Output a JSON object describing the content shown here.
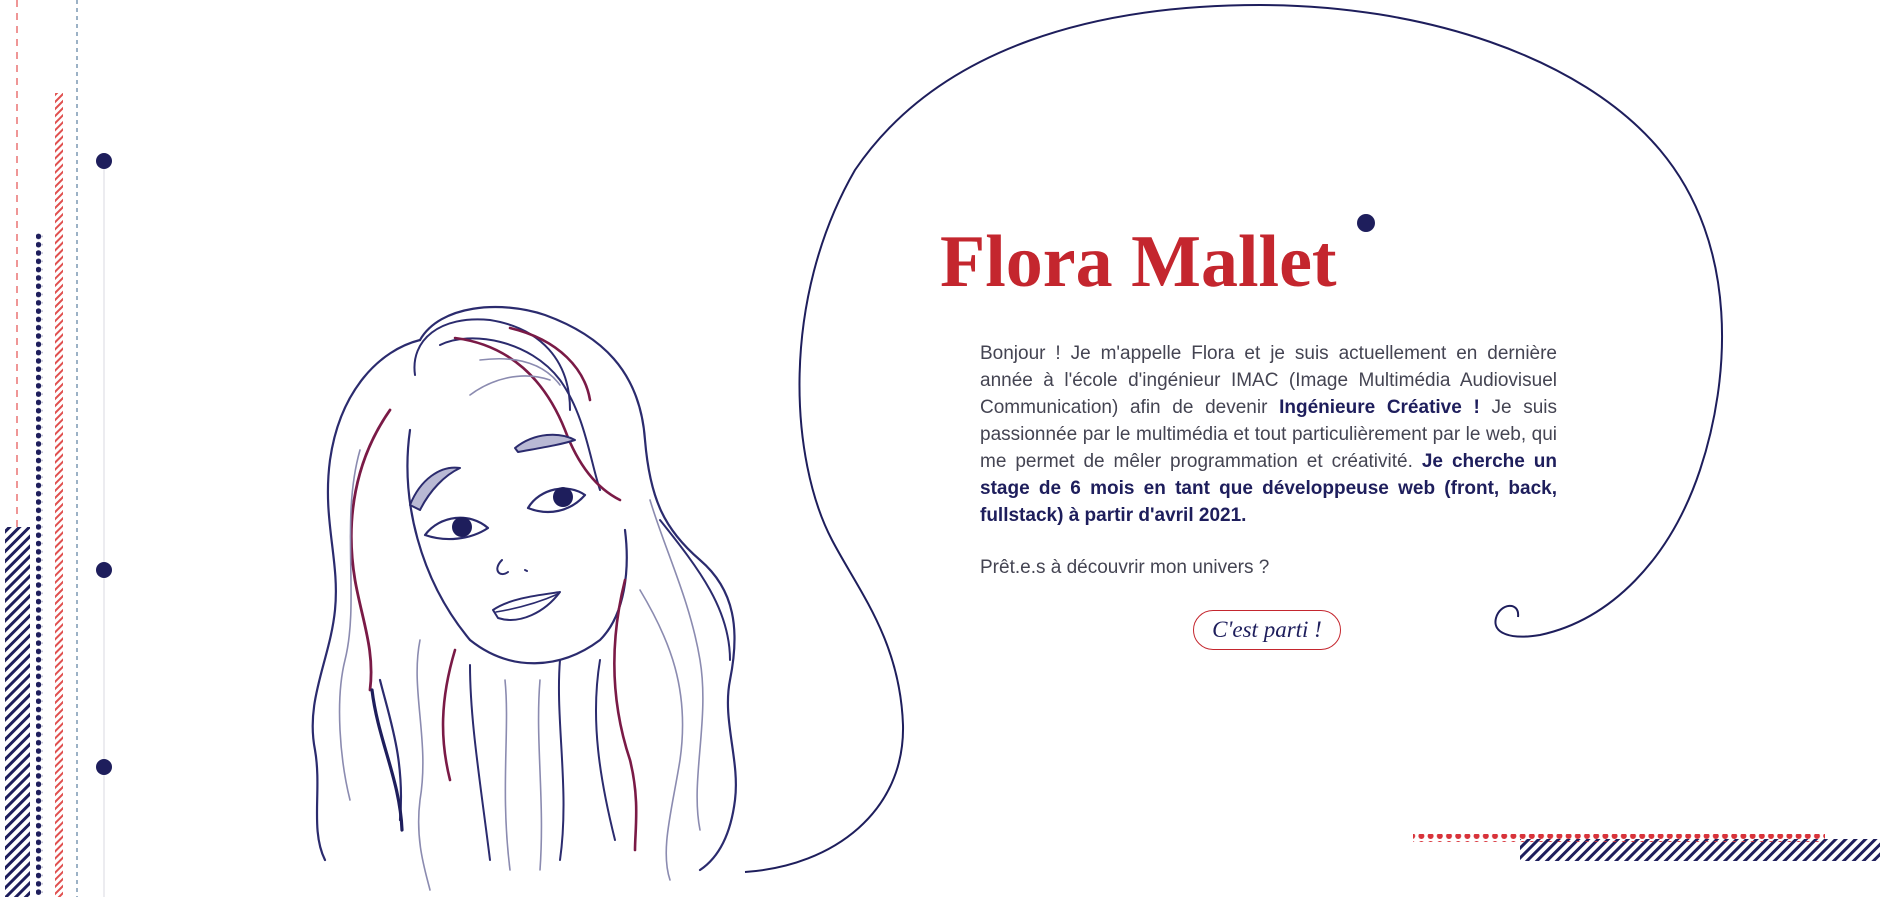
{
  "profile": {
    "name": "Flora Mallet",
    "intro_part1": "Bonjour ! Je m'appelle Flora et je suis actuellement en dernière année à l'école d'ingénieur IMAC (Image Multimédia Audiovisuel Communication) afin de devenir ",
    "intro_bold1": "Ingénieure Créative !",
    "intro_part2": " Je suis passionnée par le multimédia et tout particulièrement par le web, qui me permet de mêler programmation et créativité. ",
    "intro_bold2": "Je cherche un stage de 6 mois en tant que développeuse web (front, back, fullstack) à partir d'avril 2021.",
    "question": "Prêt.e.s à découvrir mon univers ?",
    "cta_label": "C'est parti !"
  },
  "colors": {
    "navy": "#1e1e5c",
    "red": "#c4262e",
    "burgundy": "#7a1a46",
    "text": "#444452"
  },
  "illustration": "portrait-line-drawing"
}
